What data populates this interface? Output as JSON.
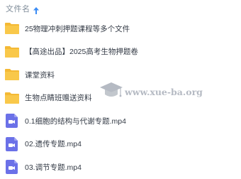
{
  "header": {
    "column_label": "文件名",
    "sort_icon": "arrow-up-icon"
  },
  "files": [
    {
      "name": "25物理冲刺押题课程等多个文件",
      "type": "folder"
    },
    {
      "name": "【高途出品】2025高考生物押题卷",
      "type": "folder"
    },
    {
      "name": "课堂资料",
      "type": "folder"
    },
    {
      "name": "生物点睛班赠送资料",
      "type": "folder"
    },
    {
      "name": "0.1细胞的结构与代谢专题.mp4",
      "type": "video"
    },
    {
      "name": "02.遗传专题.mp4",
      "type": "video"
    },
    {
      "name": "03.调节专题.mp4",
      "type": "video"
    }
  ],
  "watermark": {
    "text": "www.xue-ba.org"
  },
  "colors": {
    "folder": "#f9c84a",
    "folder_tab": "#f4b935",
    "video": "#6b71e8",
    "header_text": "#7f8c99",
    "sort_arrow": "#3b8cf5"
  }
}
